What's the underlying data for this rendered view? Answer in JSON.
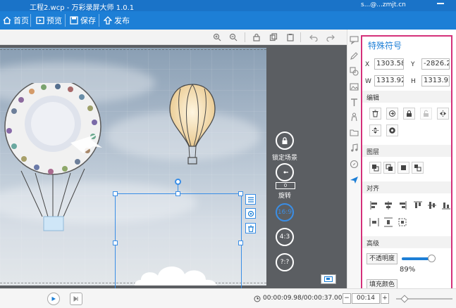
{
  "titlebar": {
    "title": "工程2.wcp - 万彩录屏大师 1.0.1",
    "account": "s...@...zmjt.cn"
  },
  "toolbar": {
    "home": "首页",
    "preview": "预览",
    "save": "保存",
    "publish": "发布"
  },
  "canvas_side": {
    "lock_label": "锁定场景",
    "rotation_value": "0",
    "rotate_label": "旋转",
    "ratio_169": "16:9",
    "ratio_43": "4:3",
    "ratio_custom": "?:?"
  },
  "panel": {
    "title": "特殊符号",
    "x_label": "X",
    "x_value": "1303.58",
    "y_label": "Y",
    "y_value": "-2826.2",
    "w_label": "W",
    "w_value": "1313.92",
    "h_label": "H",
    "h_value": "1313.92",
    "sections": {
      "edit": "编辑",
      "layer": "图层",
      "align": "对齐",
      "advanced": "高级"
    },
    "opacity_label": "不透明度",
    "opacity_percent": "89%",
    "opacity_level": 0.89,
    "partial_label": "填充颜色"
  },
  "bottombar": {
    "time": "00:00:09.98/00:00:37.00",
    "zoom": "00:14"
  },
  "colors": {
    "accent": "#1d7fd6",
    "panel_border": "#d4317a"
  }
}
